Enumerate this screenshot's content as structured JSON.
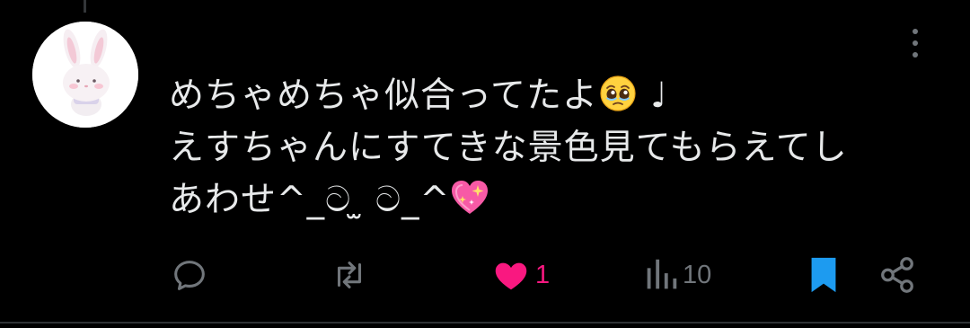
{
  "tweet": {
    "lines": [
      "めちゃめちゃ似合ってたよ",
      "えすちゃんにすてきな景色見てもらえてし",
      "あわせ^_ට ̫ ට_^"
    ],
    "line1_tail": "♩",
    "emoji": {
      "line1": "pleading-face-icon",
      "line3": "sparkling-heart-icon"
    }
  },
  "actions": {
    "reply_count": "",
    "retweet_count": "",
    "like_count": "1",
    "views_count": "10"
  },
  "colors": {
    "background": "#000000",
    "text": "#e7e9ea",
    "muted": "#71767b",
    "like": "#f91880",
    "bookmark": "#1d9bf0"
  }
}
